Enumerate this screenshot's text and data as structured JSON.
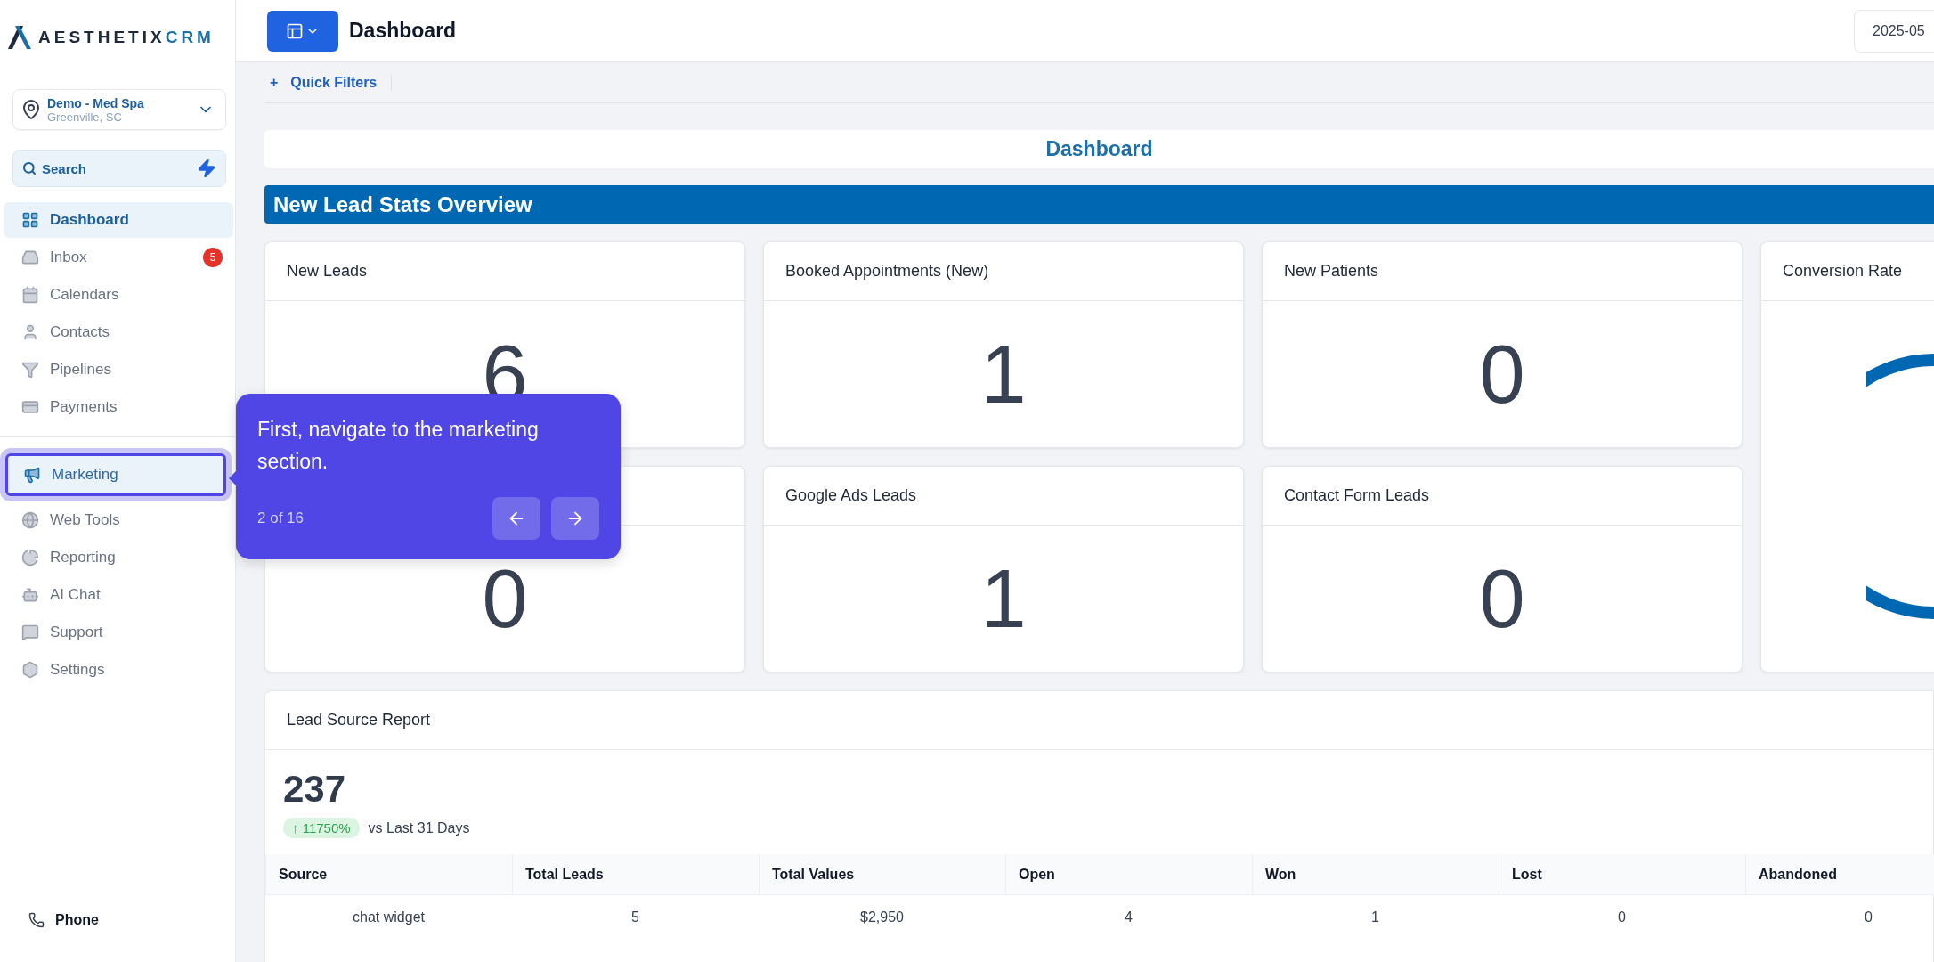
{
  "sidebar": {
    "logo": {
      "text": "AESTHETIX",
      "accent": "CRM"
    },
    "location": {
      "name": "Demo - Med Spa",
      "place": "Greenville, SC"
    },
    "search": {
      "label": "Search"
    },
    "items": [
      {
        "label": "Dashboard",
        "selected": true,
        "highlighted": false
      },
      {
        "label": "Inbox",
        "selected": false,
        "highlighted": false,
        "badge": "5"
      },
      {
        "label": "Calendars",
        "selected": false,
        "highlighted": false
      },
      {
        "label": "Contacts",
        "selected": false,
        "highlighted": false
      },
      {
        "label": "Pipelines",
        "selected": false,
        "highlighted": false
      },
      {
        "label": "Payments",
        "selected": false,
        "highlighted": false
      },
      {
        "label": "Marketing",
        "selected": false,
        "highlighted": true
      },
      {
        "label": "Web Tools",
        "selected": false,
        "highlighted": false
      },
      {
        "label": "Reporting",
        "selected": false,
        "highlighted": false
      },
      {
        "label": "AI Chat",
        "selected": false,
        "highlighted": false
      },
      {
        "label": "Support",
        "selected": false,
        "highlighted": false
      },
      {
        "label": "Settings",
        "selected": false,
        "highlighted": false
      }
    ],
    "phone": {
      "label": "Phone"
    }
  },
  "header": {
    "title": "Dashboard",
    "date": "2025-05"
  },
  "quick_filters": {
    "label": "Quick Filters",
    "icon": "+"
  },
  "dashboard_title": "Dashboard",
  "section_title": "New Lead Stats Overview",
  "stat_cards": [
    {
      "title": "New Leads",
      "value": "6"
    },
    {
      "title": "Booked Appointments (New)",
      "value": "1"
    },
    {
      "title": "New Patients",
      "value": "0"
    },
    {
      "title": "Conversion Rate",
      "kind": "ring"
    },
    {
      "value": "0"
    },
    {
      "title": "Google Ads Leads",
      "value": "1"
    },
    {
      "title": "Contact Form Leads",
      "value": "0"
    }
  ],
  "lead_source_report": {
    "title": "Lead Source Report",
    "total": "237",
    "change": "↑ 11750%",
    "comparison": "vs Last 31 Days",
    "columns": [
      "Source",
      "Total Leads",
      "Total Values",
      "Open",
      "Won",
      "Lost",
      "Abandoned"
    ],
    "rows": [
      [
        "chat widget",
        "5",
        "$2,950",
        "4",
        "1",
        "0",
        "0"
      ]
    ]
  },
  "tour": {
    "text": "First, navigate to the marketing section.",
    "step": "2 of 16"
  }
}
